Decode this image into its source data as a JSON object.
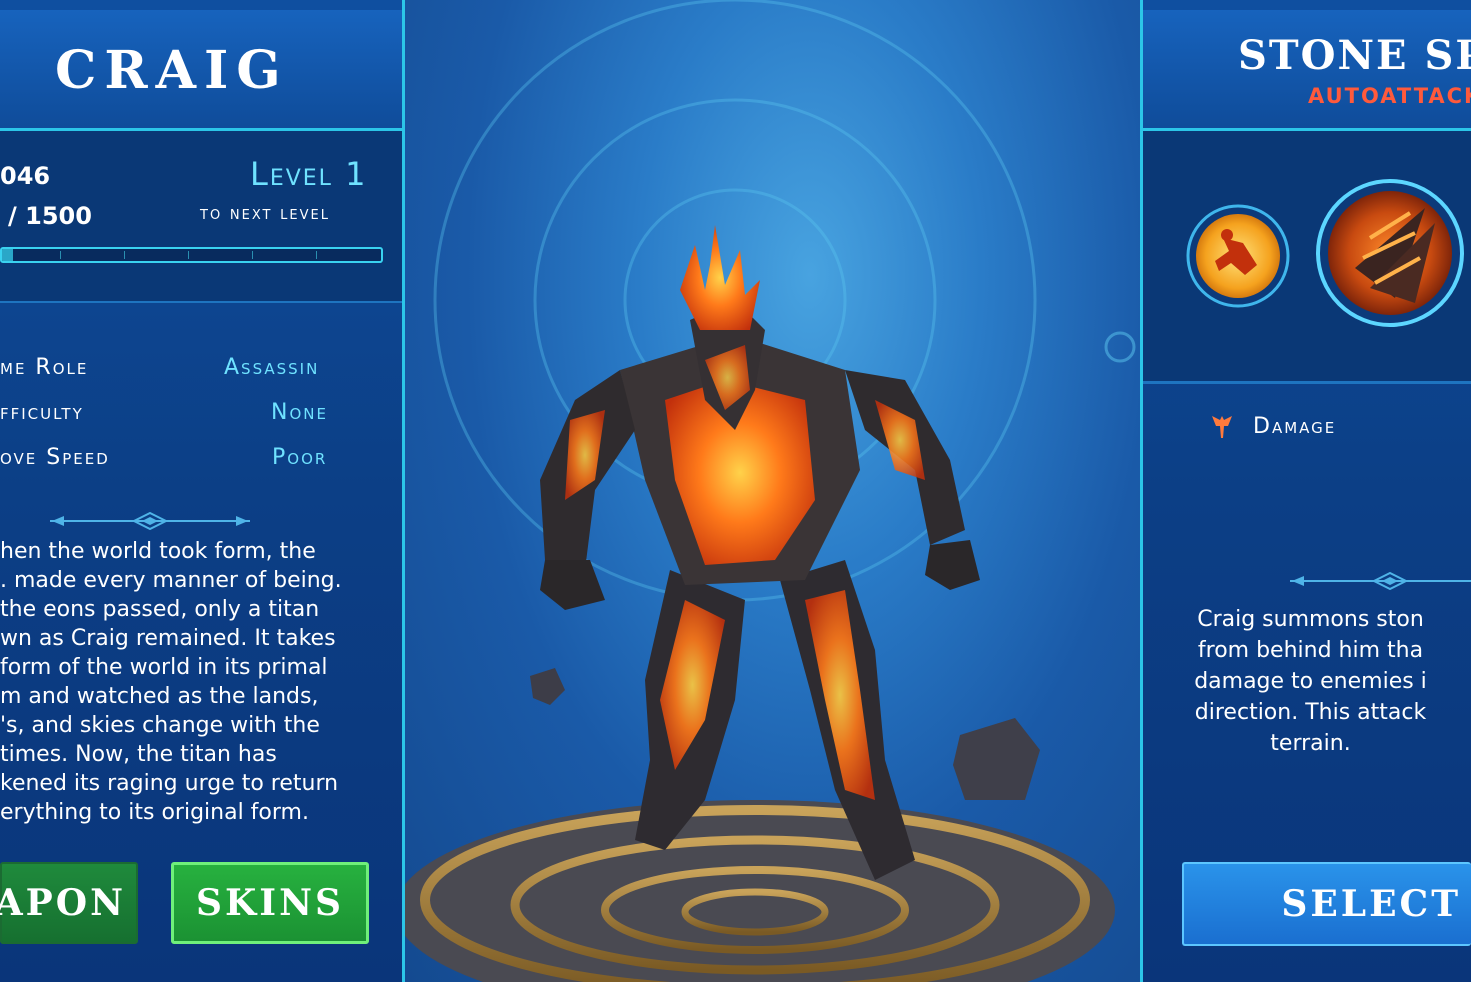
{
  "hero": {
    "name": "CRAIG",
    "xp_current": "046",
    "xp_total": "/ 1500",
    "level": "Level 1",
    "next_level": "to next level",
    "xp_fraction": 0.03
  },
  "stats": [
    {
      "label": "me Role",
      "value": "Assassin"
    },
    {
      "label": "fficulty",
      "value": "None"
    },
    {
      "label": "ove Speed",
      "value": "Poor"
    }
  ],
  "lore": [
    "hen the world took form, the",
    ". made every manner of being.",
    "the eons passed, only a titan",
    "wn as Craig remained. It takes",
    "form of the world in its primal",
    "m and watched as the lands,",
    "'s, and skies change with the",
    "times. Now, the titan has",
    "kened its raging urge to return",
    "erything to its original form."
  ],
  "buttons": {
    "weapon": "EAPON",
    "skins": "SKINS",
    "select": "SELECT"
  },
  "ability": {
    "name": "STONE SPI",
    "type": "AUTOATTACK",
    "stat_label": "Damage",
    "description": [
      "Craig summons ston",
      "from behind him tha",
      "damage to enemies i",
      "direction. This attack",
      "terrain."
    ]
  },
  "colors": {
    "accent_cyan": "#2cc6e8",
    "level_text": "#6fe2ff",
    "ability_type": "#ff5a3c",
    "skins_green": "#27b13f",
    "select_blue": "#2a93ea"
  }
}
